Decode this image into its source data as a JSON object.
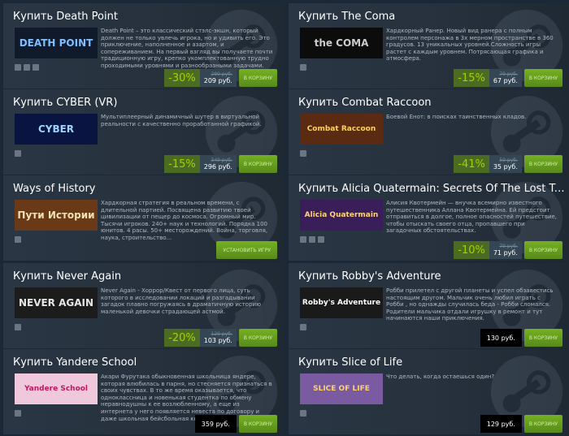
{
  "cards": [
    {
      "title": "Купить Death Point",
      "capsule_text": "DEATH POINT",
      "capsule_bg": "#101a2a",
      "capsule_fg": "#7fbfff",
      "desc": "Death Point – это классический стэлс-экшн, который должен не только увлечь игрока, но и удивить его. Это приключение, наполненное и азартом, и сопереживанием. На первый взгляд вы получаете почти традиционную игру, крепко укомплектованную трудно проходимыми уровнями и разнообразными задачами.",
      "platforms": [
        "windows-icon",
        "apple-icon",
        "steam-icon"
      ],
      "discount": "-30%",
      "original": "299 руб.",
      "final": "209 руб.",
      "cart": "В КОРЗИНУ"
    },
    {
      "title": "Купить The Coma",
      "capsule_text": "the COMA",
      "capsule_bg": "#0c0c0c",
      "capsule_fg": "#cccccc",
      "desc": "Хардкорный Ранер. Новый вид ранера с полным контролем персонажа в 3х мерном пространстве в 360 градусов. 13 уникальных уровней.Сложность игры растет с каждым уровнем. Потрясающая графика и атмосфера.",
      "platforms": [
        "windows-icon"
      ],
      "discount": "-15%",
      "original": "79 руб.",
      "final": "67 руб.",
      "cart": "В КОРЗИНУ"
    },
    {
      "title": "Купить CYBER (VR)",
      "capsule_text": "CYBER",
      "capsule_bg": "#0a1440",
      "capsule_fg": "#9fd2ff",
      "desc": "Мультиплеерный динамичный шутер в виртуальной реальности с качественно проработанной графикой.",
      "platforms": [
        "windows-icon"
      ],
      "discount": "-15%",
      "original": "349 руб.",
      "final": "296 руб.",
      "cart": "В КОРЗИНУ"
    },
    {
      "title": "Купить Combat Raccoon",
      "capsule_text": "Combat Raccoon",
      "capsule_bg": "#5a2a12",
      "capsule_fg": "#ffd35a",
      "desc": "Боевой Енот: в поисках таинственных кладов.",
      "platforms": [
        "windows-icon"
      ],
      "discount": "-41%",
      "original": "59 руб.",
      "final": "35 руб.",
      "cart": "В КОРЗИНУ"
    },
    {
      "title": "Ways of History",
      "capsule_text": "Пути Истории",
      "capsule_bg": "#6a3a18",
      "capsule_fg": "#f2dfb0",
      "desc": "Хардкорная стратегия в реальном времени, с длительной партией. Посвящена развитию твоей цивилизации от пещер до космоса. Огромный мир. Тысячи игроков. 240+ наук и технологий. Порядка 100 юнитов. 4 расы. 50+ месторождений. Война, торговля, наука, строительство...",
      "platforms": [
        "windows-icon"
      ],
      "install": "УСТАНОВИТЬ ИГРУ"
    },
    {
      "title": "Купить Alicia Quatermain: Secrets Of The Lost Treasures",
      "capsule_text": "Alicia Quatermain",
      "capsule_bg": "#3a1e5a",
      "capsule_fg": "#ffd27a",
      "desc": "Алисия Квотермейн — внучка всемирно известного путешественника Аллана Квотермейна. Ей предстоит отправиться в долгое, полное опасностей путешествие, чтобы отыскать своего отца, пропавшего при загадочных обстоятельствах.",
      "platforms": [
        "windows-icon",
        "apple-icon",
        "steam-icon"
      ],
      "discount": "-10%",
      "original": "79 руб.",
      "final": "71 руб.",
      "cart": "В КОРЗИНУ"
    },
    {
      "title": "Купить Never Again",
      "capsule_text": "NEVER AGAIN",
      "capsule_bg": "#1c1c1c",
      "capsule_fg": "#e6e6e6",
      "desc": "Never Again - Хоррор/Квест от первого лица, суть которого в исследовании локаций и разгадывании загадок плавно погружаясь в драматичную историю маленькой девочки страдающей астмой.",
      "platforms": [
        "windows-icon"
      ],
      "discount": "-20%",
      "original": "129 руб.",
      "final": "103 руб.",
      "cart": "В КОРЗИНУ"
    },
    {
      "title": "Купить Robby's Adventure",
      "capsule_text": "Robby's Adventure",
      "capsule_bg": "#1a1a1a",
      "capsule_fg": "#ffffff",
      "desc": "Робби прилетел с другой планеты и успел обзавестись настоящим другом. Мальчик очень любил играть с Робби , но однажды случилась беда - Робби сломался. Родители мальчика отдали игрушку в ремонт и тут начинаются наши приключения.",
      "platforms": [
        "windows-icon"
      ],
      "price": "130 руб.",
      "cart": "В КОРЗИНУ"
    },
    {
      "title": "Купить Yandere School",
      "capsule_text": "Yandere School",
      "capsule_bg": "#f0c8dc",
      "capsule_fg": "#c01860",
      "desc": "Акари Фурутака обыкновенная школьница яндере, которая влюбилась в парня, но стесняется признаться в своих чувствах. В то же время оказывается, что одноклассница и новенькая студентка по обмену неравнодушны к ее возлюбленному, а еще из интернета у него появляется невеста по договору и даже школьная бейсбольная команда",
      "platforms": [
        "windows-icon"
      ],
      "price": "359 руб.",
      "cart": "В КОРЗИНУ"
    },
    {
      "title": "Купить Slice of Life",
      "capsule_text": "SLICE OF LIFE",
      "capsule_bg": "#7a5aa0",
      "capsule_fg": "#ffd36a",
      "desc": "Что делать, когда остаешься один?",
      "platforms": [
        "windows-icon"
      ],
      "price": "129 руб.",
      "cart": "В КОРЗИНУ"
    }
  ]
}
